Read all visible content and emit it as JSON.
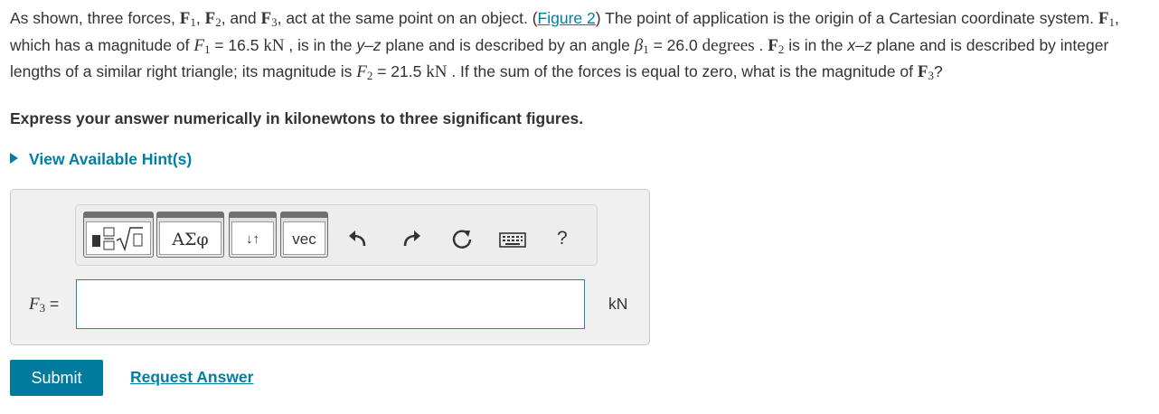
{
  "problem": {
    "t1": "As shown, three forces, ",
    "f1": "F",
    "f1_sub": "1",
    "comma1": ", ",
    "f2": "F",
    "f2_sub": "2",
    "t2": ", and ",
    "f3": "F",
    "f3_sub": "3",
    "t3": ", act at the same point on an object. (",
    "figure_link": "Figure 2",
    "t4": ") The point of application is the origin of a Cartesian coordinate system. ",
    "f1b": "F",
    "f1b_sub": "1",
    "t5": ", which has a magnitude of ",
    "f1_mag_sym": "F",
    "f1_mag_sub": "1",
    "t6": " = 16.5 ",
    "kn1": "kN",
    "t7": " , is in the ",
    "yz": "y",
    "t8": "–",
    "z1": "z",
    "t9": " plane and is described by an angle ",
    "beta": "β",
    "beta_sub": "1",
    "t10": " = 26.0 ",
    "degrees": "degrees",
    "t11": " . ",
    "f2b": "F",
    "f2b_sub": "2",
    "t12": " is in the ",
    "xz_x": "x",
    "t13": "–",
    "xz_z": "z",
    "t14": " plane and is described by integer lengths of a similar right triangle; its magnitude is ",
    "f2_mag_sym": "F",
    "f2_mag_sub": "2",
    "t15": " = 21.5 ",
    "kn2": "kN",
    "t16": " .  If the sum of the forces is equal to zero, what is the magnitude of ",
    "f3b": "F",
    "f3b_sub": "3",
    "t17": "?"
  },
  "instruction": "Express your answer numerically in kilonewtons to three significant figures.",
  "hints_label": "View Available Hint(s)",
  "toolbar": {
    "greek": "ΑΣφ",
    "vec": "vec",
    "arrows": "↓↑",
    "help": "?"
  },
  "answer": {
    "label_sym": "F",
    "label_sub": "3",
    "label_eq": " =",
    "value": "",
    "placeholder": "",
    "unit": "kN"
  },
  "submit_label": "Submit",
  "request_label": "Request Answer",
  "colors": {
    "accent": "#007b9e",
    "link": "#007fa3",
    "input_border": "#2a84a3"
  }
}
